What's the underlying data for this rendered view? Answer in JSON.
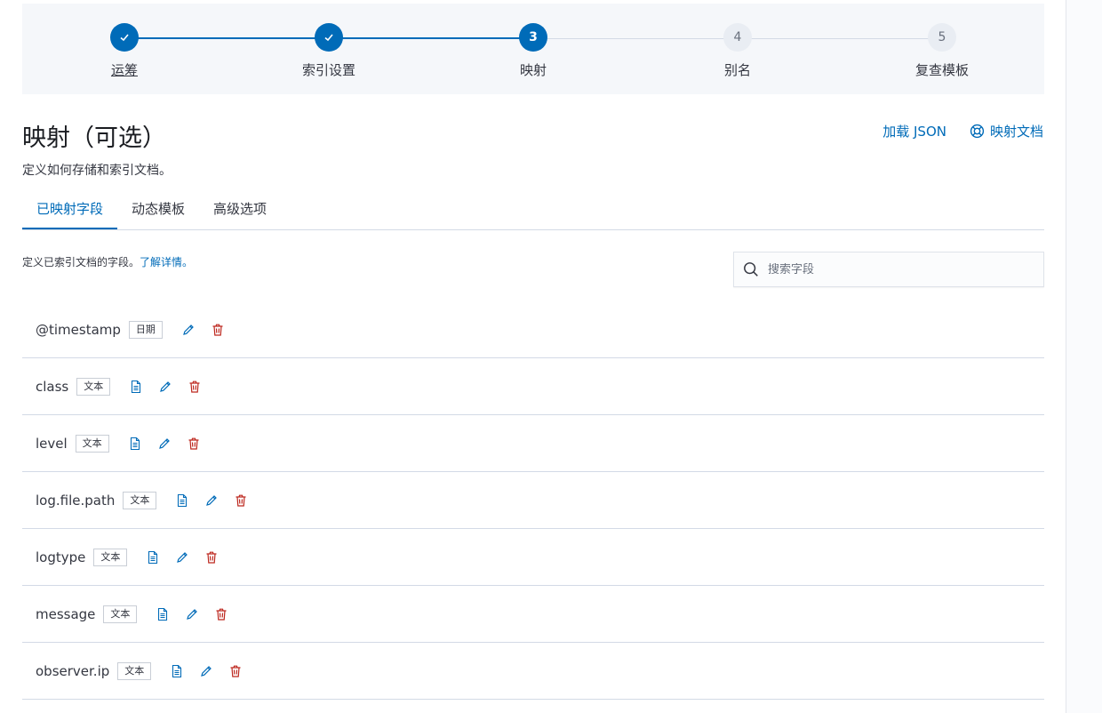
{
  "steps": [
    {
      "label": "运筹",
      "number": "1",
      "status": "done"
    },
    {
      "label": "索引设置",
      "number": "2",
      "status": "done"
    },
    {
      "label": "映射",
      "number": "3",
      "status": "current"
    },
    {
      "label": "别名",
      "number": "4",
      "status": "todo"
    },
    {
      "label": "复查模板",
      "number": "5",
      "status": "todo"
    }
  ],
  "header": {
    "title": "映射（可选）",
    "description": "定义如何存储和索引文档。",
    "load_json": "加载 JSON",
    "docs": "映射文档"
  },
  "tabs": [
    {
      "label": "已映射字段",
      "active": true
    },
    {
      "label": "动态模板",
      "active": false
    },
    {
      "label": "高级选项",
      "active": false
    }
  ],
  "tab_description": {
    "text": "定义已索引文档的字段。",
    "link": "了解详情。"
  },
  "search": {
    "placeholder": "搜索字段"
  },
  "fields": [
    {
      "name": "@timestamp",
      "type": "日期",
      "has_doc_icon": false
    },
    {
      "name": "class",
      "type": "文本",
      "has_doc_icon": true
    },
    {
      "name": "level",
      "type": "文本",
      "has_doc_icon": true
    },
    {
      "name": "log.file.path",
      "type": "文本",
      "has_doc_icon": true
    },
    {
      "name": "logtype",
      "type": "文本",
      "has_doc_icon": true
    },
    {
      "name": "message",
      "type": "文本",
      "has_doc_icon": true
    },
    {
      "name": "observer.ip",
      "type": "文本",
      "has_doc_icon": true
    }
  ],
  "colors": {
    "primary": "#006bb8",
    "danger": "#bd271e",
    "border": "#d3dae6"
  },
  "icons": {
    "check": "check-icon",
    "docs": "lifebuoy-icon",
    "search": "search-icon",
    "doc": "document-icon",
    "edit": "pencil-icon",
    "delete": "trash-icon"
  }
}
